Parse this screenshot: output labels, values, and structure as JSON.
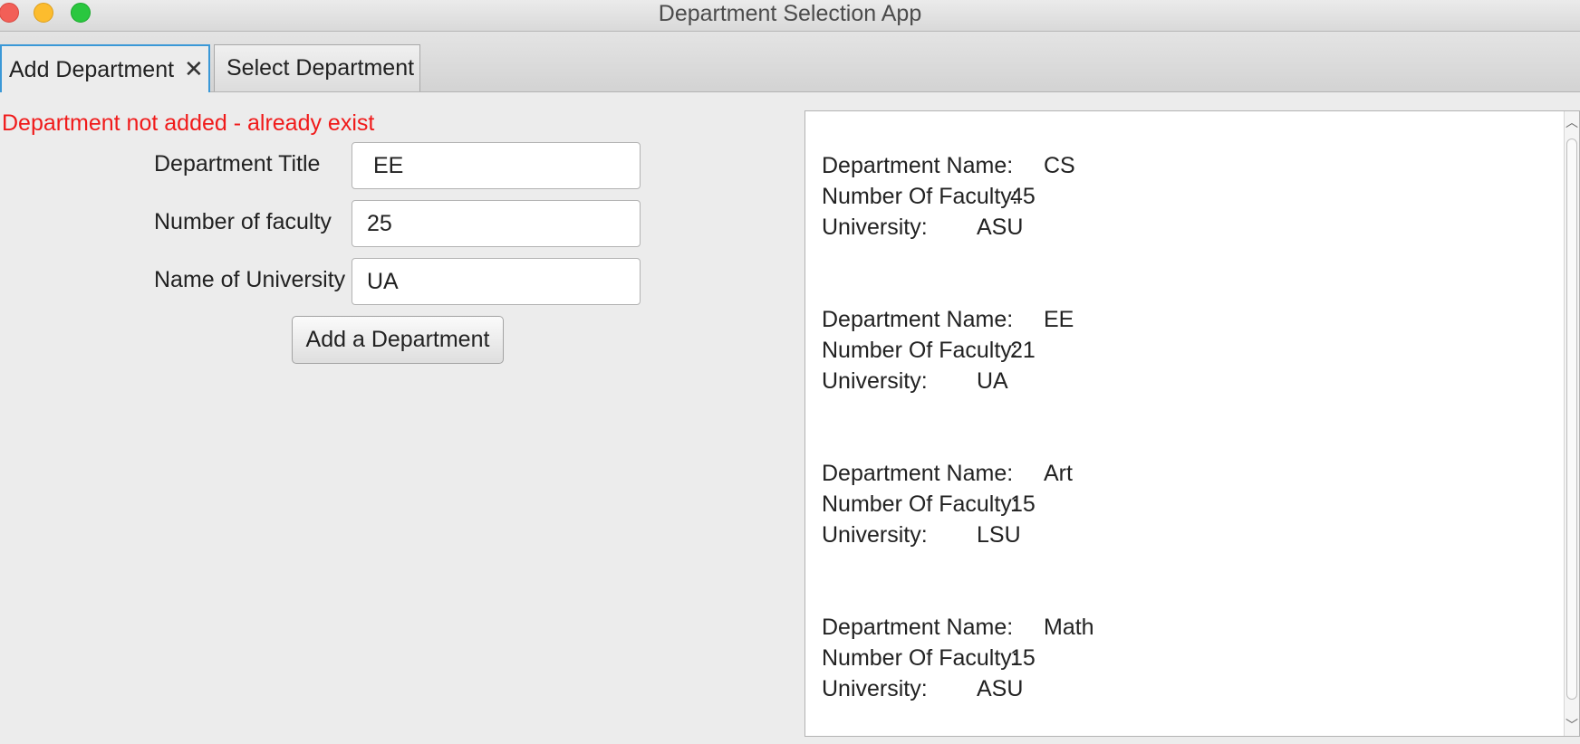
{
  "window": {
    "title": "Department Selection App"
  },
  "tabs": [
    {
      "label": "Add Department",
      "close": "✕"
    },
    {
      "label": "Select Department"
    }
  ],
  "form": {
    "status_message": "Department not added - already exist",
    "title_label": "Department Title",
    "title_value": " EE",
    "faculty_label": "Number of faculty",
    "faculty_value": "25",
    "university_label": "Name of University",
    "university_value": "UA",
    "add_button": "Add a Department"
  },
  "list": {
    "name_key": "Department Name:",
    "faculty_key": "Number Of Faculty:",
    "university_key": "University:",
    "departments": [
      {
        "name": "CS",
        "faculty": "45",
        "university": "ASU"
      },
      {
        "name": " EE",
        "faculty": "21",
        "university": "UA"
      },
      {
        "name": " Art",
        "faculty": "15",
        "university": "LSU"
      },
      {
        "name": "Math",
        "faculty": "15",
        "university": "ASU"
      }
    ]
  },
  "colors": {
    "error": "#f01a1a",
    "tab_focus": "#3a98d7"
  }
}
